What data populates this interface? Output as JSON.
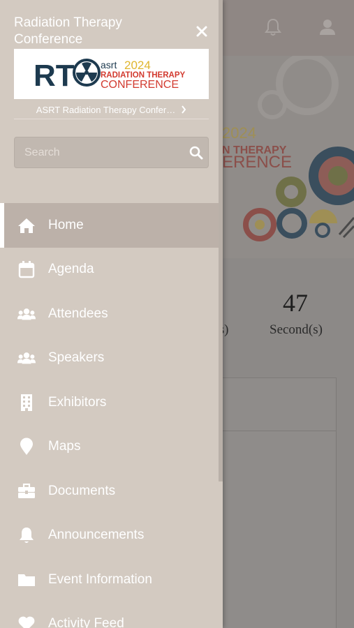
{
  "drawer": {
    "title": "Radiation Therapy Conference",
    "logo": {
      "letters": "RT",
      "brand": "asrt",
      "year": "2024",
      "line1": "RADIATION THERAPY",
      "line2": "CONFERENCE"
    },
    "event_link": "ASRT Radiation Therapy Confer…",
    "search": {
      "placeholder": "Search",
      "value": ""
    },
    "nav": [
      {
        "label": "Home",
        "icon": "home-icon",
        "active": true
      },
      {
        "label": "Agenda",
        "icon": "calendar-icon",
        "active": false
      },
      {
        "label": "Attendees",
        "icon": "users-icon",
        "active": false
      },
      {
        "label": "Speakers",
        "icon": "users-icon",
        "active": false
      },
      {
        "label": "Exhibitors",
        "icon": "building-icon",
        "active": false
      },
      {
        "label": "Maps",
        "icon": "map-pin-icon",
        "active": false
      },
      {
        "label": "Documents",
        "icon": "briefcase-icon",
        "active": false
      },
      {
        "label": "Announcements",
        "icon": "bell-icon",
        "active": false
      },
      {
        "label": "Event Information",
        "icon": "folder-icon",
        "active": false
      },
      {
        "label": "Activity Feed",
        "icon": "heart-icon",
        "active": false
      }
    ]
  },
  "background": {
    "banner": {
      "year": "2024",
      "line1": "N THERAPY",
      "line2": "ERENCE"
    },
    "countdown": {
      "minutes_value": "",
      "minutes_label": "e(s)",
      "seconds_value": "47",
      "seconds_label": "Second(s)"
    }
  },
  "colors": {
    "drawer_bg": "#d3cac1",
    "active_item_bg": "#bcb1a9",
    "text": "#ffffff",
    "brand_navy": "#1d3a4f",
    "brand_red": "#d23a2f",
    "brand_yellow": "#e0b62f"
  }
}
